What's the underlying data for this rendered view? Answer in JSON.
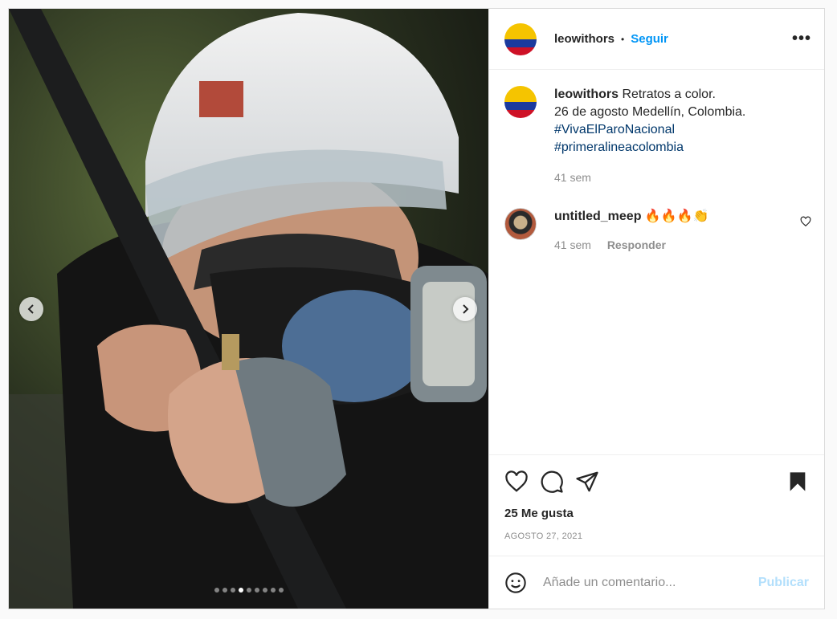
{
  "post": {
    "username": "leowithors",
    "separator": "•",
    "follow_label": "Seguir",
    "more_label": "•••",
    "image_alt": "photo of protester in helmet with bow",
    "carousel": {
      "total": 9,
      "active_index": 3
    }
  },
  "caption": {
    "username": "leowithors",
    "text": "Retratos a color.",
    "line2": "26 de agosto Medellín, Colombia.",
    "tags": [
      "#VivaElParoNacional",
      "#primeralineacolombia"
    ],
    "age": "41 sem"
  },
  "comments": [
    {
      "username": "untitled_meep",
      "text": "🔥🔥🔥👏",
      "age": "41 sem",
      "reply_label": "Responder"
    }
  ],
  "likes": "25 Me gusta",
  "date": "AGOSTO 27, 2021",
  "add_comment": {
    "placeholder": "Añade un comentario...",
    "post_label": "Publicar"
  },
  "icons": [
    "heart-icon",
    "comment-icon",
    "share-icon",
    "bookmark-icon",
    "emoji-icon",
    "chevron-left-icon",
    "chevron-right-icon"
  ],
  "colors": {
    "accent": "#0095f6",
    "hashtag": "#00376b",
    "muted": "#8e8e8e",
    "post_disabled": "#b2dffc"
  }
}
